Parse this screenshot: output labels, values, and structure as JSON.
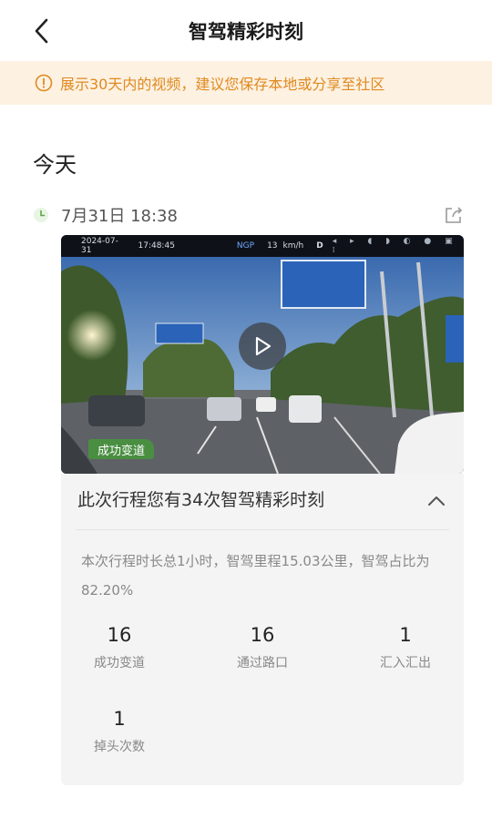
{
  "header": {
    "title": "智驾精彩时刻",
    "back_icon": "chevron-left-icon"
  },
  "notice": {
    "icon": "info-circle-icon",
    "text": "展示30天内的视频，建议您保存本地或分享至社区",
    "color": "#e08a1e",
    "background": "#fdf1e2"
  },
  "section": {
    "label": "今天"
  },
  "item": {
    "time": "7月31日 18:38",
    "share_icon": "share-icon",
    "video": {
      "osd_date": "2024-07-31",
      "osd_time": "17:48:45",
      "osd_mode": "NGP",
      "osd_speed": "13",
      "osd_unit": "km/h",
      "osd_gear": "D",
      "tag": "成功变道",
      "play_icon": "play-icon"
    },
    "panel": {
      "title": "此次行程您有34次智驾精彩时刻",
      "collapse_icon": "chevron-up-icon",
      "summary": "本次行程时长总1小时，智驾里程15.03公里，智驾占比为82.20%",
      "stats": [
        {
          "value": "16",
          "label": "成功变道"
        },
        {
          "value": "16",
          "label": "通过路口"
        },
        {
          "value": "1",
          "label": "汇入汇出"
        },
        {
          "value": "1",
          "label": "掉头次数"
        }
      ]
    }
  }
}
